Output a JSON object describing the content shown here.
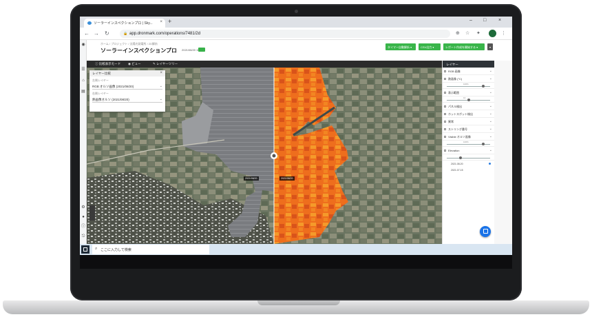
{
  "browser": {
    "tab_title": "ソーラーインスペクションプロ | Sky...",
    "url": "app.dronmark.com/operations/7481/2d",
    "win_controls": [
      "–",
      "□",
      "×"
    ]
  },
  "app": {
    "breadcrumb": "ホーム / プロジェクト / 太陽光発電所 / 2D解析",
    "page_title": "ソーラーインスペクションプロ",
    "page_date": "2021/08/20 15:56",
    "header_buttons": [
      {
        "label": "タイマー自動解析 ▾",
        "dark": false
      },
      {
        "label": "CSV出力 ▾",
        "dark": false
      },
      {
        "label": "レポート作成を開始する ▾",
        "dark": false
      }
    ],
    "map_toolbar": [
      "ⓘ 比較表示モード",
      "◉ ビュー",
      "✎ レイヤーツリー"
    ],
    "layer_panel": {
      "title": "レイヤー比較",
      "label1": "左側レイヤー",
      "value1": "RGB オルソ画像 (2021/08/20)",
      "label2": "右側レイヤー",
      "value2": "熱画像オルソ (2021/08/20)"
    },
    "map_labels": [
      "2021/08/20",
      "2021/08/20"
    ],
    "right_panel": {
      "title": "レイヤー",
      "rows": [
        {
          "type": "row",
          "label": "RGB 画像"
        },
        {
          "type": "row",
          "label": "熱画像 (°C)"
        },
        {
          "type": "slider",
          "value": "100%",
          "pos": 0.85
        },
        {
          "type": "row",
          "label": "表示範囲"
        },
        {
          "type": "slider",
          "value": "10",
          "pos": 0.5
        },
        {
          "type": "row",
          "label": "パネル検出"
        },
        {
          "type": "row",
          "label": "ホットスポット検出"
        },
        {
          "type": "row",
          "label": "異常"
        },
        {
          "type": "row",
          "label": "ストリング番号"
        },
        {
          "type": "row",
          "label": "Visible オルソ画像"
        },
        {
          "type": "slider",
          "value": "100%",
          "pos": 0.85
        },
        {
          "type": "row",
          "label": "Elevation"
        },
        {
          "type": "slider",
          "value": "",
          "pos": 0.3
        },
        {
          "type": "date",
          "label": "2021.08.20"
        },
        {
          "type": "date",
          "label": "2021.07.15"
        }
      ]
    },
    "taskbar": {
      "search_placeholder": "ここに入力して検索"
    }
  },
  "colors": {
    "accent_green": "#39b54a",
    "thermal_orange": "#f07a20",
    "chat_blue": "#1a73e8"
  }
}
